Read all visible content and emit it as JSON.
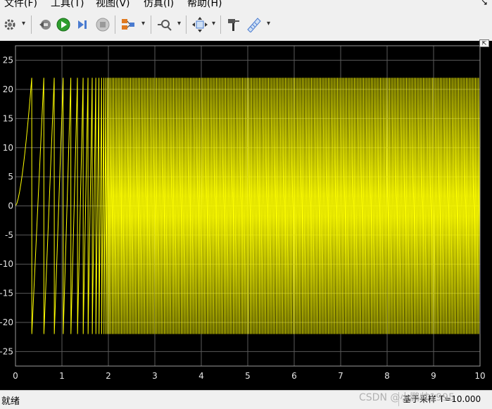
{
  "menu": {
    "items": [
      "文件(F)",
      "工具(T)",
      "视图(V)",
      "仿真(I)",
      "帮助(H)"
    ]
  },
  "toolbar": {
    "icons": [
      "settings-gear",
      "step-back",
      "run",
      "step-forward",
      "stop",
      "highlight-simulink",
      "zoom",
      "autoscale",
      "style",
      "measurements"
    ]
  },
  "colors": {
    "plot_bg": "#000000",
    "axes_bg": "#000000",
    "trace": "#ffff00",
    "grid": "#5a5a5a",
    "window_bg": "#f0f0f0"
  },
  "chart_data": {
    "type": "line",
    "title": "",
    "xlabel": "",
    "ylabel": "",
    "xlim": [
      0,
      10
    ],
    "ylim": [
      -27.5,
      27.5
    ],
    "xticks": [
      "0",
      "1",
      "2",
      "3",
      "4",
      "5",
      "6",
      "7",
      "8",
      "9",
      "10"
    ],
    "yticks": [
      "25",
      "20",
      "15",
      "10",
      "5",
      "0",
      "-5",
      "-10",
      "-15",
      "-20",
      "-25"
    ],
    "grid": true,
    "series": [
      {
        "description_of_signal": "sawtooth-like oscillation with increasing frequency",
        "color": "#ffff00",
        "amplitude_max": 22,
        "amplitude_min": -22,
        "x_start": 0,
        "y_start": 0,
        "first_peak_x": 0.35,
        "first_peak_y": 22,
        "first_trough_y": -22,
        "approx_cycles_over_range": 300
      }
    ]
  },
  "status": {
    "left": "就绪",
    "right": "基于采样 T=10.000",
    "watermark": "CSDN @小鹏帅1995"
  }
}
